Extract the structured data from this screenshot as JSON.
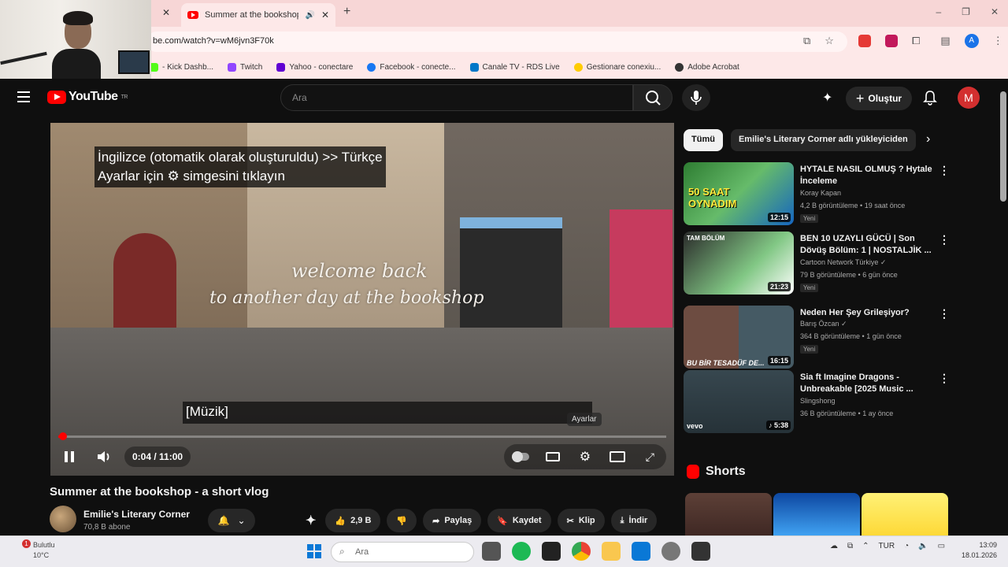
{
  "browser": {
    "tab_title": "Summer at the bookshop",
    "url": "be.com/watch?v=wM6jvn3F70k",
    "bookmarks": [
      {
        "label": "- Kick Dashb...",
        "color": "#53fc18"
      },
      {
        "label": "Twitch",
        "color": "#9146ff"
      },
      {
        "label": "Yahoo - conectare",
        "color": "#6001d2"
      },
      {
        "label": "Facebook - conecte...",
        "color": "#1877f2"
      },
      {
        "label": "Canale TV - RDS Live",
        "color": "#0077c8"
      },
      {
        "label": "Gestionare conexiu...",
        "color": "#ffcc00"
      },
      {
        "label": "Adobe Acrobat",
        "color": "#333333"
      }
    ],
    "profile_initial": "A",
    "window_controls": [
      "–",
      "❐",
      "✕"
    ]
  },
  "youtube": {
    "logo": "YouTube",
    "logo_suffix": "TR",
    "search_placeholder": "Ara",
    "create_label": "Oluştur",
    "avatar_initial": "M"
  },
  "player": {
    "auto_subtitle_line1": "İngilizce (otomatik olarak oluşturuldu) >> Türkçe",
    "auto_subtitle_line2": "Ayarlar için  ⚙  simgesini tıklayın",
    "overlay_line1": "welcome back",
    "overlay_line2": "to another day at the bookshop",
    "caption": "[Müzik]",
    "settings_tooltip": "Ayarlar",
    "time": "0:04 / 11:00",
    "progress": 0.006
  },
  "video": {
    "title": "Summer at the bookshop - a short vlog",
    "channel": "Emilie's Literary Corner",
    "subscribers": "70,8 B abone",
    "likes": "2,9 B",
    "share_label": "Paylaş",
    "save_label": "Kaydet",
    "clip_label": "Klip",
    "download_label": "İndir"
  },
  "sidebar": {
    "chips": [
      "Tümü",
      "Emilie's Literary Corner adlı yükleyiciden"
    ],
    "recommendations": [
      {
        "title": "HYTALE NASIL OLMUŞ ? Hytale İnceleme",
        "channel": "Koray Kapan",
        "meta": "4,2 B görüntüleme • 19 saat önce",
        "badge": "Yeni",
        "duration": "12:15",
        "thumb_text": "50 SAAT OYNADIM"
      },
      {
        "title": "BEN 10 UZAYLI GÜCÜ | Son Dövüş Bölüm: 1 | NOSTALJİK ...",
        "channel": "Cartoon Network Türkiye ✓",
        "meta": "79 B görüntüleme • 6 gün önce",
        "badge": "Yeni",
        "duration": "21:23",
        "thumb_text": "TAM BÖLÜM"
      },
      {
        "title": "Neden Her Şey Grileşiyor?",
        "channel": "Barış Özcan ✓",
        "meta": "364 B görüntüleme • 1 gün önce",
        "badge": "Yeni",
        "duration": "16:15",
        "thumb_text": "BU BİR TESADÜF DE..."
      },
      {
        "title": "Sia ft Imagine Dragons - Unbreakable [2025 Music ...",
        "channel": "Slingshong",
        "meta": "36 B görüntüleme • 1 ay önce",
        "badge": "",
        "duration": "♪ 5:38",
        "thumb_text": "vevo"
      }
    ],
    "shorts_label": "Shorts"
  },
  "taskbar": {
    "weather_line1": "Bulutlu",
    "weather_line2": "10°C",
    "weather_badge": "1",
    "search_placeholder": "Ara",
    "lang": "TUR",
    "time": "13:09",
    "date": "18.01.2026"
  }
}
